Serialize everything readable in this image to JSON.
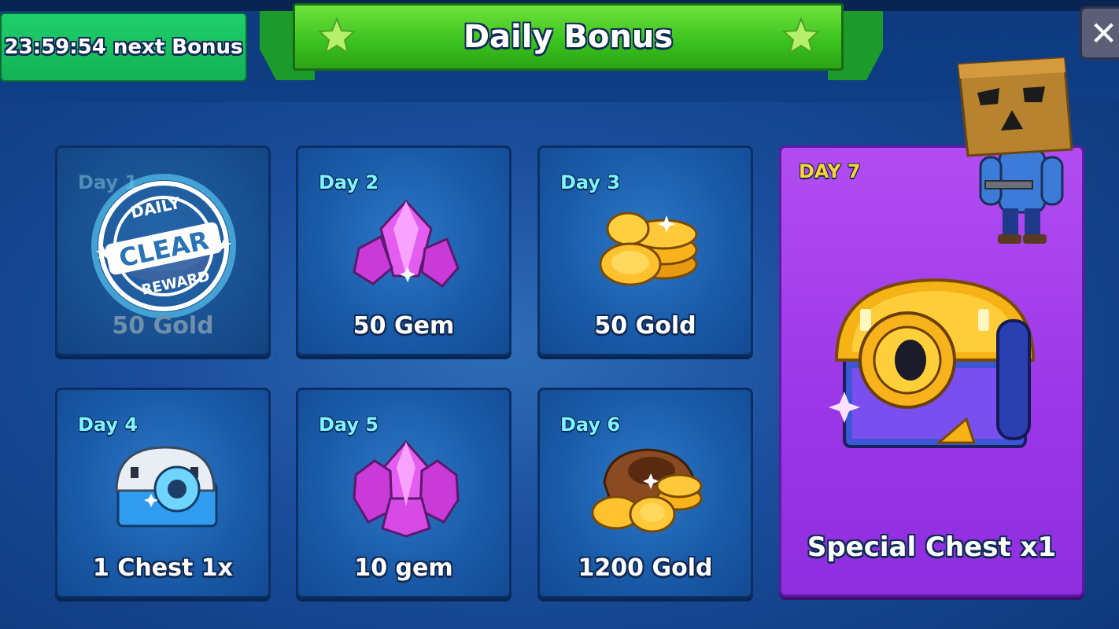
{
  "timer": {
    "text": "23:59:54 next Bonus"
  },
  "header": {
    "title": "Daily Bonus",
    "close_glyph": "✕"
  },
  "stamp": {
    "top": "DAILY",
    "middle": "CLEAR",
    "bottom": "REWARD"
  },
  "rewards": [
    {
      "day": "Day 1",
      "reward": "50 Gold",
      "icon": "gold-coins-icon",
      "claimed": true
    },
    {
      "day": "Day 2",
      "reward": "50 Gem",
      "icon": "gems-icon",
      "claimed": false
    },
    {
      "day": "Day 3",
      "reward": "50 Gold",
      "icon": "gold-coins-icon",
      "claimed": false
    },
    {
      "day": "Day 4",
      "reward": "1 Chest 1x",
      "icon": "silver-chest-icon",
      "claimed": false
    },
    {
      "day": "Day 5",
      "reward": "10 gem",
      "icon": "gems-icon",
      "claimed": false
    },
    {
      "day": "Day 6",
      "reward": "1200 Gold",
      "icon": "gold-sack-icon",
      "claimed": false
    },
    {
      "day": "DAY 7",
      "reward": "Special Chest x1",
      "icon": "special-chest-icon",
      "claimed": false
    }
  ],
  "colors": {
    "timer_bg": "#1fcf6b",
    "banner_bg": "#39c11e",
    "card_bg": "#1a5caa",
    "special_bg": "#9a36e6",
    "day_label": "#7ff3ff",
    "special_day_label": "#ffd234"
  }
}
